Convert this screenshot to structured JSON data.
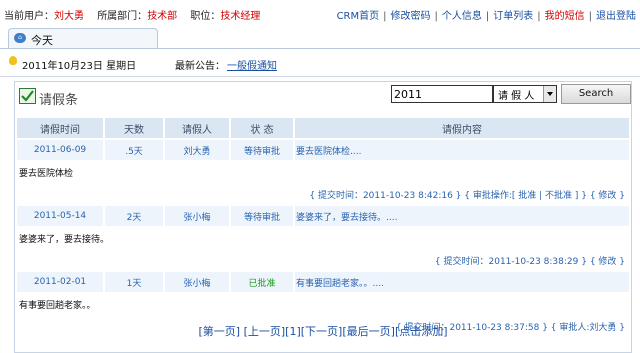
{
  "topbar": {
    "user_label": "当前用户：",
    "user_name": "刘大勇",
    "dept_label": "所属部门：",
    "dept_name": "技术部",
    "position_label": "职位：",
    "position_name": "技术经理",
    "links": [
      "CRM首页",
      "修改密码",
      "个人信息",
      "订单列表",
      "我的短信",
      "退出登陆"
    ],
    "sep": "|"
  },
  "tab": {
    "label": "今天",
    "icon": "home-icon"
  },
  "infobar": {
    "date": "2011年10月23日  星期日",
    "notice_label": "最新公告：",
    "notice_link": "一般假通知"
  },
  "panel": {
    "title": "请假条",
    "search_value": "2011",
    "search_select": "请 假 人",
    "search_button": "Search"
  },
  "table": {
    "headers": [
      "请假时间",
      "天数",
      "请假人",
      "状 态",
      "请假内容"
    ],
    "rows": [
      {
        "date": "2011-06-09",
        "days": ".5天",
        "person": "刘大勇",
        "status": "等待审批",
        "content": "要去医院体检....",
        "detail": "要去医院体检",
        "meta": "{ 提交时间：2011-10-23 8:42:16 } { 审批操作:[ 批准 | 不批准 ] } { 修改 }"
      },
      {
        "date": "2011-05-14",
        "days": "2天",
        "person": "张小梅",
        "status": "等待审批",
        "content": "婆婆来了，要去接待。....",
        "detail": "婆婆来了，要去接待。",
        "meta": "{ 提交时间：2011-10-23 8:38:29 } { 修改 }"
      },
      {
        "date": "2011-02-01",
        "days": "1天",
        "person": "张小梅",
        "status": "已批准",
        "content": "有事要回趟老家。。....",
        "detail": "有事要回趟老家。。",
        "meta": "{ 提交时间：2011-10-23 8:37:58 } { 审批人:刘大勇 }"
      }
    ]
  },
  "pager": {
    "first": "[第一页]",
    "prev": "[上一页]",
    "current": "[1]",
    "next": "[下一页]",
    "last": "[最后一页]",
    "add": "[点击添加]"
  },
  "colors": {
    "accent_blue": "#1a4fa0",
    "red": "#d40000",
    "header_bg": "#dbe6f3",
    "row_bg": "#eef4fb",
    "approved": "#1e9a1e"
  }
}
